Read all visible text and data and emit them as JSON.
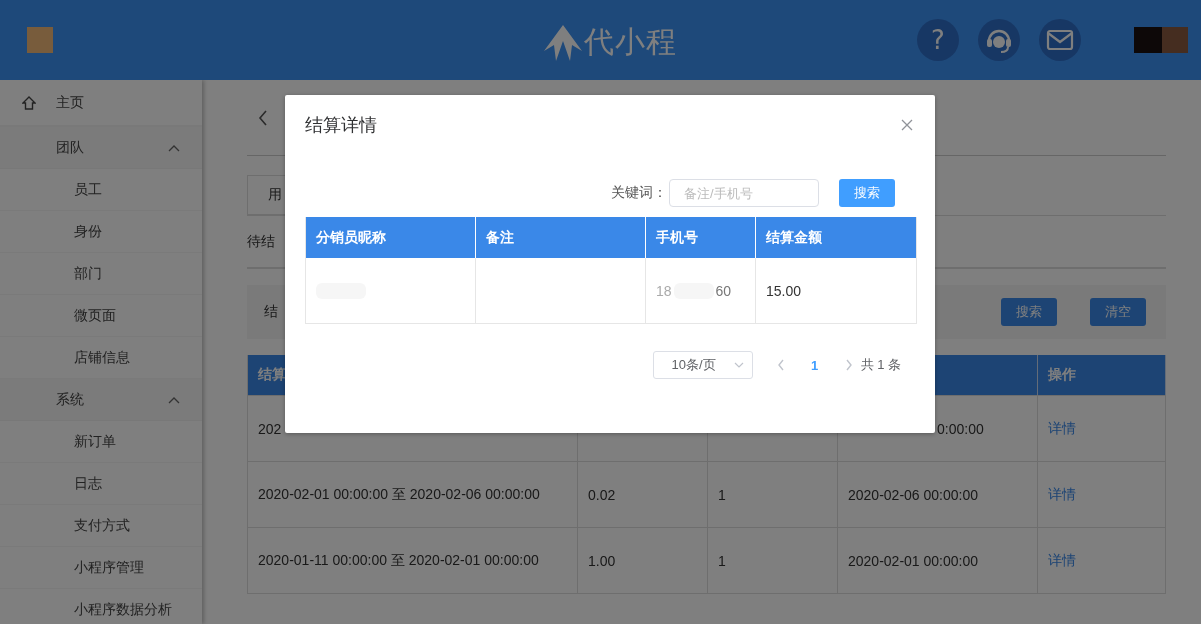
{
  "header": {
    "logo_text": "代小程",
    "help_icon": "?"
  },
  "sidebar": {
    "items": [
      {
        "kind": "home",
        "label": "主页"
      },
      {
        "kind": "group",
        "label": "团队",
        "expanded": true,
        "children": [
          {
            "label": "员工"
          },
          {
            "label": "身份"
          },
          {
            "label": "部门"
          },
          {
            "label": "微页面"
          },
          {
            "label": "店铺信息"
          }
        ]
      },
      {
        "kind": "group",
        "label": "系统",
        "expanded": true,
        "children": [
          {
            "label": "新订单"
          },
          {
            "label": "日志"
          },
          {
            "label": "支付方式"
          },
          {
            "label": "小程序管理"
          },
          {
            "label": "小程序数据分析"
          }
        ]
      }
    ]
  },
  "main": {
    "tab_label": "用",
    "section_title": "待结",
    "filter_label": "结",
    "filter_buttons": [
      "搜索",
      "清空"
    ],
    "table": {
      "first_header": "结算",
      "last_header": "操作",
      "rows": [
        {
          "period": "202",
          "end_time": "0:00:00",
          "clipped": true,
          "action": "详情"
        },
        {
          "period": "2020-02-01 00:00:00  至  2020-02-06 00:00:00",
          "amount": "0.02",
          "count": "1",
          "end_time": "2020-02-06 00:00:00",
          "clipped": false,
          "action": "详情"
        },
        {
          "period": "2020-01-11 00:00:00  至  2020-02-01 00:00:00",
          "amount": "1.00",
          "count": "1",
          "end_time": "2020-02-01 00:00:00",
          "clipped": false,
          "action": "详情"
        }
      ]
    }
  },
  "dialog": {
    "title": "结算详情",
    "keyword_label": "关键词：",
    "keyword_placeholder": "备注/手机号",
    "search_button": "搜索",
    "columns": [
      "分销员昵称",
      "备注",
      "手机号",
      "结算金额"
    ],
    "rows": [
      {
        "name_redacted": true,
        "phone_start": "18",
        "phone_end": "60",
        "amount": "15.00"
      }
    ],
    "pagination": {
      "page_size": "10条/页",
      "pages": [
        {
          "label": "1",
          "selected": true
        }
      ],
      "total": "共 1 条"
    }
  }
}
